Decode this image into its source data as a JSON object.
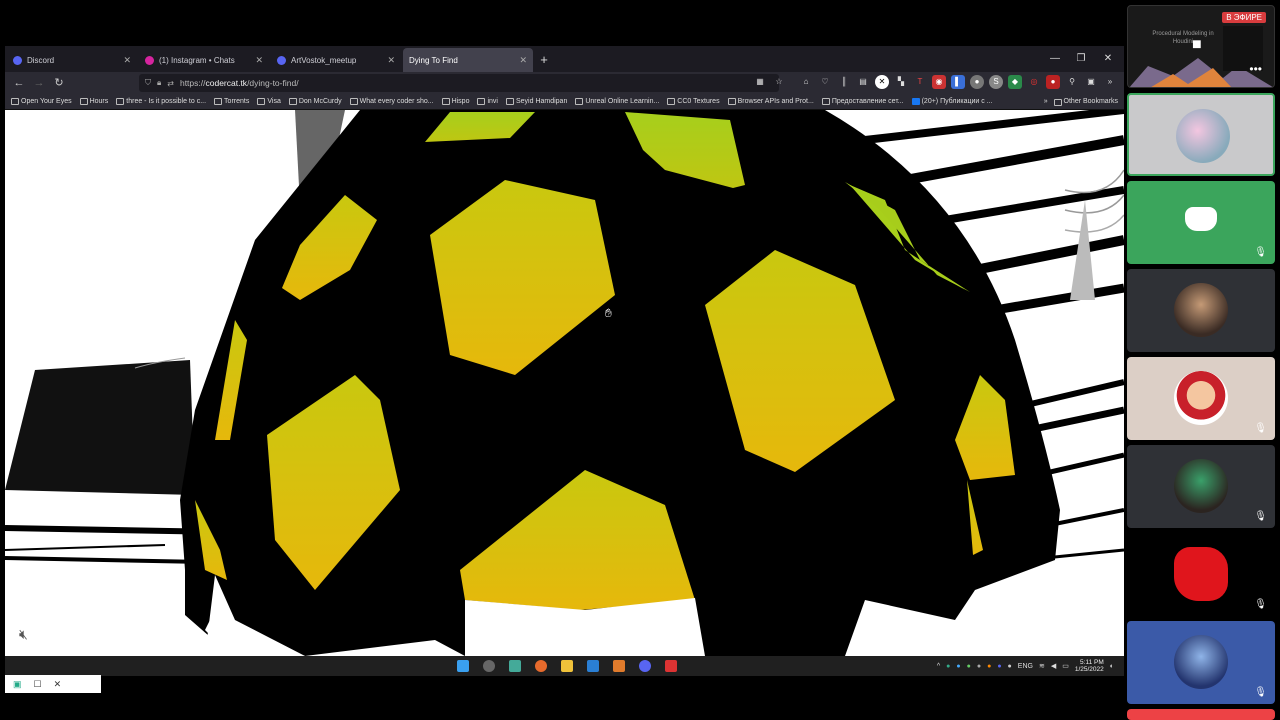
{
  "browser": {
    "tabs": [
      {
        "label": "Discord",
        "fav_color": "#5865f2"
      },
      {
        "label": "(1) Instagram • Chats",
        "fav_color": "#d6249f"
      },
      {
        "label": "ArtVostok_meetup",
        "fav_color": "#5865f2"
      },
      {
        "label": "Dying To Find",
        "fav_color": ""
      }
    ],
    "new_tab": "+",
    "url_prefix": "https://",
    "url_host": "codercat.tk",
    "url_path": "/dying-to-find/",
    "bookmarks": [
      "Open Your Eyes",
      "Hours",
      "three - Is it possible to c...",
      "Torrents",
      "Visa",
      "Don McCurdy",
      "What every coder sho...",
      "Hispo",
      "invi",
      "Seyid Hamdipan",
      "Unreal Online Learnin...",
      "CC0 Textures",
      "Browser APIs and Prot...",
      "Предоставление сет...",
      "(20+) Публикации с ..."
    ],
    "other_bookmarks": "Other Bookmarks"
  },
  "taskbar": {
    "lang": "ENG",
    "time": "5:11 PM",
    "date": "1/25/2022"
  },
  "discord": {
    "live_badge": "В ЭФИРЕ",
    "stream_title": "Procedural Modeling in Houdini",
    "more": "•••"
  },
  "colors": {
    "hex_yellow": "#e3c00a",
    "hex_green": "#a7cc1b",
    "discord_green": "#3ba55c",
    "discord_blurple": "#5865f2"
  }
}
